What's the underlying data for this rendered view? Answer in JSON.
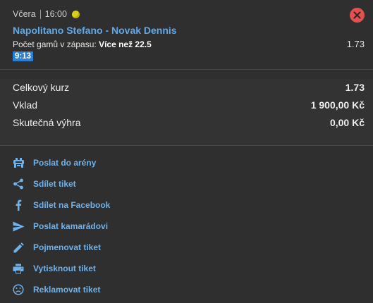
{
  "bet": {
    "day": "Včera",
    "time": "16:00",
    "ball_icon": "tennis-ball-icon",
    "match": "Napolitano Stefano - Novak Dennis",
    "market_label": "Počet gamů v zápasu:",
    "selection": "Více než 22.5",
    "odds": "1.73",
    "badge": "9:13",
    "close_icon": "close-icon"
  },
  "summary": [
    {
      "label": "Celkový kurz",
      "value": "1.73"
    },
    {
      "label": "Vklad",
      "value": "1 900,00 Kč"
    },
    {
      "label": "Skutečná výhra",
      "value": "0,00 Kč"
    }
  ],
  "actions": [
    {
      "icon": "arena-icon",
      "label": "Poslat do arény"
    },
    {
      "icon": "share-icon",
      "label": "Sdílet tiket"
    },
    {
      "icon": "facebook-icon",
      "label": "Sdílet na Facebook"
    },
    {
      "icon": "send-icon",
      "label": "Poslat kamarádovi"
    },
    {
      "icon": "pencil-icon",
      "label": "Pojmenovat tiket"
    },
    {
      "icon": "printer-icon",
      "label": "Vytisknout tiket"
    },
    {
      "icon": "sad-face-icon",
      "label": "Reklamovat tiket"
    }
  ],
  "colors": {
    "accent": "#5fa9ea",
    "badge": "#2b7fd4",
    "close": "#e25050",
    "background": "#2f2f2f"
  }
}
